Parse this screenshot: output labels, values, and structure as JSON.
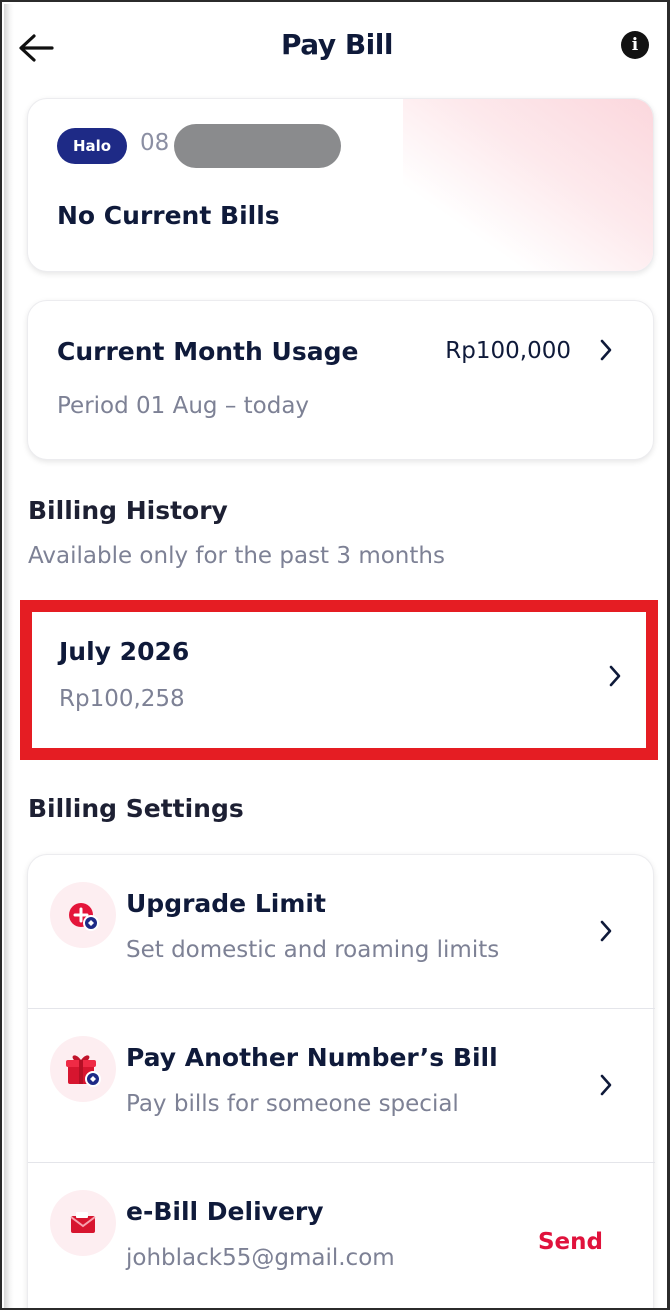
{
  "header": {
    "title": "Pay Bill",
    "back_icon": "arrow-left-icon",
    "info_icon": "info-icon",
    "info_glyph": "i"
  },
  "bill_card": {
    "badge": "Halo",
    "phone_prefix": "08",
    "status": "No Current Bills"
  },
  "usage_card": {
    "title": "Current Month Usage",
    "amount": "Rp100,000",
    "period": "Period 01 Aug – today"
  },
  "billing_history": {
    "title": "Billing History",
    "subtitle": "Available only for the past 3 months",
    "items": [
      {
        "month": "July 2026",
        "amount": "Rp100,258"
      }
    ]
  },
  "billing_settings": {
    "title": "Billing Settings",
    "items": [
      {
        "title": "Upgrade Limit",
        "subtitle": "Set domestic and roaming limits",
        "icon": "upgrade-limit-icon"
      },
      {
        "title": "Pay Another Number’s Bill",
        "subtitle": "Pay bills for someone special",
        "icon": "gift-icon"
      },
      {
        "title": "e-Bill Delivery",
        "subtitle": "johblack55@gmail.com",
        "icon": "envelope-icon",
        "action": "Send"
      }
    ]
  },
  "colors": {
    "navy": "#0f1a3a",
    "badge": "#1e2a86",
    "accent_red": "#e0123c",
    "highlight_border": "#e51d23",
    "muted_text": "#7d8195"
  }
}
